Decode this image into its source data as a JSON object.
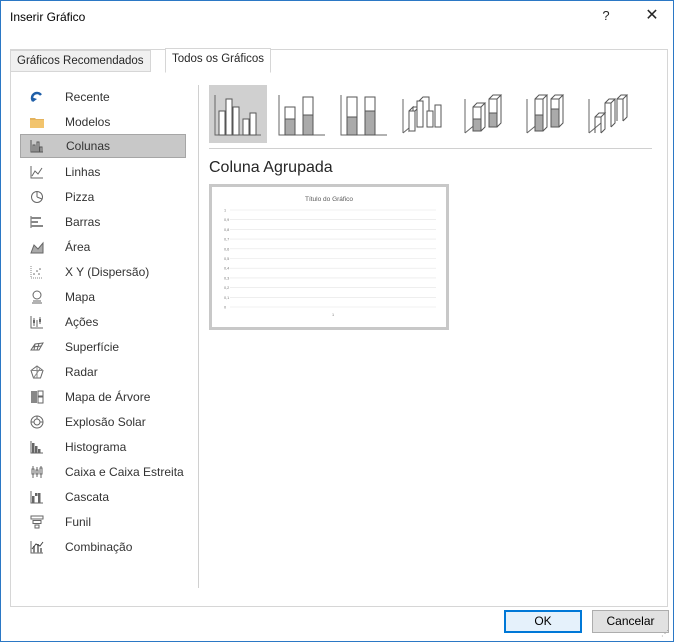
{
  "window": {
    "title": "Inserir Gráfico",
    "help_label": "?",
    "close_label": "✕"
  },
  "tabs": [
    {
      "label": "Gráficos Recomendados",
      "active": false
    },
    {
      "label": "Todos os Gráficos",
      "active": true
    }
  ],
  "sidebar": {
    "selected": "Colunas",
    "items": [
      {
        "label": "Recente",
        "icon": "recent-icon"
      },
      {
        "label": "Modelos",
        "icon": "folder-icon"
      },
      {
        "label": "Colunas",
        "icon": "column-chart-icon"
      },
      {
        "label": "Linhas",
        "icon": "line-chart-icon"
      },
      {
        "label": "Pizza",
        "icon": "pie-chart-icon"
      },
      {
        "label": "Barras",
        "icon": "bar-chart-icon"
      },
      {
        "label": "Área",
        "icon": "area-chart-icon"
      },
      {
        "label": "X Y (Dispersão)",
        "icon": "scatter-chart-icon"
      },
      {
        "label": "Mapa",
        "icon": "map-chart-icon"
      },
      {
        "label": "Ações",
        "icon": "stock-chart-icon"
      },
      {
        "label": "Superfície",
        "icon": "surface-chart-icon"
      },
      {
        "label": "Radar",
        "icon": "radar-chart-icon"
      },
      {
        "label": "Mapa de Árvore",
        "icon": "treemap-chart-icon"
      },
      {
        "label": "Explosão Solar",
        "icon": "sunburst-chart-icon"
      },
      {
        "label": "Histograma",
        "icon": "histogram-chart-icon"
      },
      {
        "label": "Caixa e Caixa Estreita",
        "icon": "box-whisker-chart-icon"
      },
      {
        "label": "Cascata",
        "icon": "waterfall-chart-icon"
      },
      {
        "label": "Funil",
        "icon": "funnel-chart-icon"
      },
      {
        "label": "Combinação",
        "icon": "combo-chart-icon"
      }
    ]
  },
  "subtypes": {
    "selected_index": 0,
    "selected_title": "Coluna Agrupada",
    "items": [
      "clustered-column-icon",
      "stacked-column-icon",
      "100-stacked-column-icon",
      "3d-clustered-column-icon",
      "3d-stacked-column-icon",
      "3d-100-stacked-column-icon",
      "3d-column-icon"
    ]
  },
  "preview": {
    "chart_data": {
      "type": "bar",
      "title": "Título do Gráfico",
      "categories": [
        "1"
      ],
      "series": [],
      "yticks": [
        "1",
        "0,9",
        "0,8",
        "0,7",
        "0,6",
        "0,5",
        "0,4",
        "0,3",
        "0,2",
        "0,1",
        "0"
      ],
      "ylim": [
        0,
        1
      ],
      "grid": true
    }
  },
  "buttons": {
    "ok": "OK",
    "cancel": "Cancelar"
  },
  "colors": {
    "accent": "#0078d7",
    "selected_bg": "#c8c8c8",
    "window_border": "#2b78c5"
  }
}
